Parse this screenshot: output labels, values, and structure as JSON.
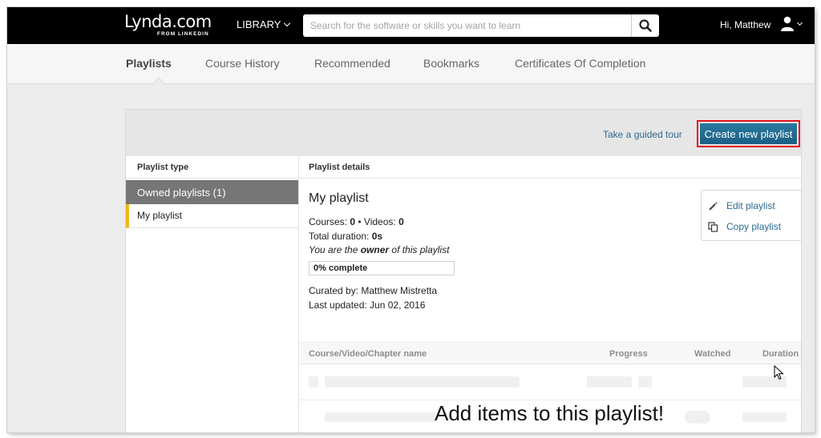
{
  "topbar": {
    "logo_text": "Lynda.com",
    "logo_sub": "FROM LINKEDIN",
    "library_label": "LIBRARY",
    "search_placeholder": "Search for the software or skills you want to learn",
    "greeting": "Hi, Matthew"
  },
  "tabs": [
    {
      "label": "Playlists",
      "active": true
    },
    {
      "label": "Course History"
    },
    {
      "label": "Recommended"
    },
    {
      "label": "Bookmarks"
    },
    {
      "label": "Certificates Of Completion"
    }
  ],
  "panel": {
    "tour_link": "Take a guided tour",
    "create_button": "Create new playlist",
    "left_header": "Playlist type",
    "right_header": "Playlist details",
    "group_title": "Owned playlists (1)",
    "playlist_item": "My playlist"
  },
  "details": {
    "name": "My playlist",
    "courses_label": "Courses: ",
    "courses_value": "0",
    "separator": " • ",
    "videos_label": "Videos: ",
    "videos_value": "0",
    "duration_label": "Total duration: ",
    "duration_value": "0s",
    "owner_prefix": "You are the ",
    "owner_word": "owner",
    "owner_suffix": " of this playlist",
    "progress_label": "0% complete",
    "progress_fraction": 0,
    "curated_by": "Curated by: Matthew Mistretta",
    "last_updated": "Last updated: Jun 02, 2016"
  },
  "actions": {
    "edit": "Edit playlist",
    "copy": "Copy playlist"
  },
  "table": {
    "col_name": "Course/Video/Chapter name",
    "col_progress": "Progress",
    "col_watched": "Watched",
    "col_duration": "Duration",
    "empty_message": "Add items to this playlist!"
  },
  "colors": {
    "accent_blue": "#1b5f84",
    "link_blue": "#2d6a8f",
    "highlight_red": "#e2131d",
    "selected_yellow": "#f0b71a"
  },
  "icons": [
    "search-icon",
    "chevron-down-icon",
    "user-icon",
    "pencil-icon",
    "copy-icon",
    "mouse-cursor-icon"
  ]
}
